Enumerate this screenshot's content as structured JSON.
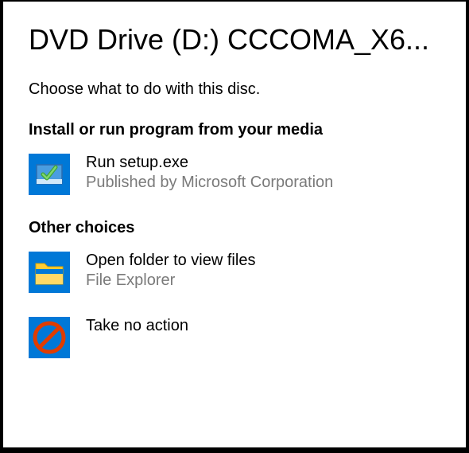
{
  "dialog": {
    "title": "DVD Drive (D:) CCCOMA_X6...",
    "subtitle": "Choose what to do with this disc.",
    "section_install": "Install or run program from your media",
    "section_other": "Other choices",
    "options": {
      "run_setup": {
        "title": "Run setup.exe",
        "sub": "Published by Microsoft Corporation"
      },
      "open_folder": {
        "title": "Open folder to view files",
        "sub": "File Explorer"
      },
      "no_action": {
        "title": "Take no action"
      }
    }
  }
}
